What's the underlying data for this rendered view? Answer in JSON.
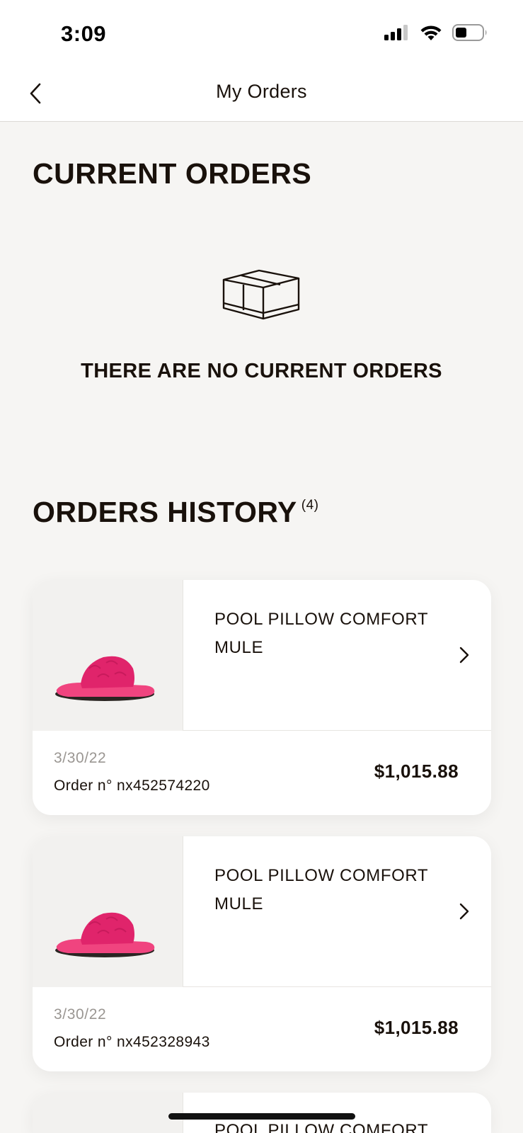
{
  "status_bar": {
    "time": "3:09",
    "icons": [
      "cellular-signal-icon",
      "wifi-icon",
      "battery-icon"
    ]
  },
  "nav": {
    "back_icon": "chevron-left-icon",
    "title": "My Orders"
  },
  "current_orders": {
    "title": "CURRENT ORDERS",
    "empty_icon": "package-box-icon",
    "empty_message": "THERE ARE NO CURRENT ORDERS"
  },
  "history": {
    "title": "ORDERS HISTORY",
    "count": "(4)",
    "orders": [
      {
        "name": "POOL PILLOW COMFORT MULE",
        "date": "3/30/22",
        "order_number": "Order n° nx452574220",
        "price": "$1,015.88",
        "image_icon": "pink-slide-sandal-image"
      },
      {
        "name": "POOL PILLOW COMFORT MULE",
        "date": "3/30/22",
        "order_number": "Order n° nx452328943",
        "price": "$1,015.88",
        "image_icon": "pink-slide-sandal-image"
      },
      {
        "name": "POOL PILLOW COMFORT"
      }
    ]
  },
  "colors": {
    "background": "#f6f5f3",
    "text": "#19110b",
    "card": "#ffffff",
    "product_pink": "#ec2f7b"
  }
}
